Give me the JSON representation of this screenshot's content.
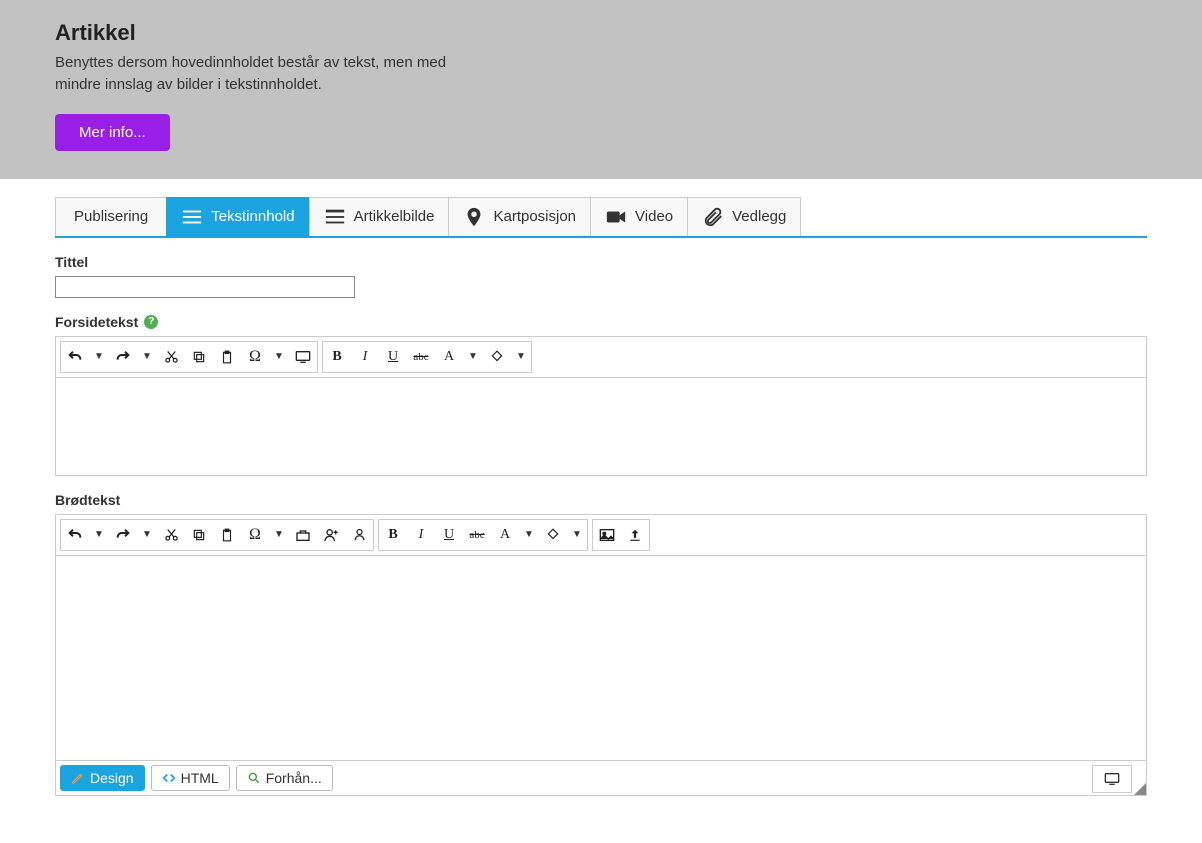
{
  "header": {
    "title": "Artikkel",
    "description": "Benyttes dersom hovedinnholdet består av tekst, men med mindre innslag av bilder i tekstinnholdet.",
    "more_label": "Mer info..."
  },
  "tabs": [
    {
      "label": "Publisering",
      "icon": "none"
    },
    {
      "label": "Tekstinnhold",
      "icon": "lines",
      "active": true
    },
    {
      "label": "Artikkelbilde",
      "icon": "lines2"
    },
    {
      "label": "Kartposisjon",
      "icon": "pin"
    },
    {
      "label": "Video",
      "icon": "camera"
    },
    {
      "label": "Vedlegg",
      "icon": "clip"
    }
  ],
  "labels": {
    "tittel": "Tittel",
    "forsidetekst": "Forsidetekst",
    "brodtekst": "Brødtekst"
  },
  "tittel_value": "",
  "editor_modes": {
    "design": "Design",
    "html": "HTML",
    "preview": "Forhån..."
  },
  "toolbar_icons": {
    "undo": "↺",
    "redo": "↻",
    "dropdown": "▼",
    "cut": "✂",
    "copy": "⧉",
    "paste": "📋",
    "omega": "Ω",
    "display": "▭",
    "bold": "B",
    "italic": "I",
    "underline": "U",
    "strike": "abc",
    "fontcolor": "A",
    "bgcolor": "◈",
    "tools": "🧰",
    "person-add": "👤+",
    "person": "👤",
    "image": "🖼",
    "upload": "⬆"
  }
}
